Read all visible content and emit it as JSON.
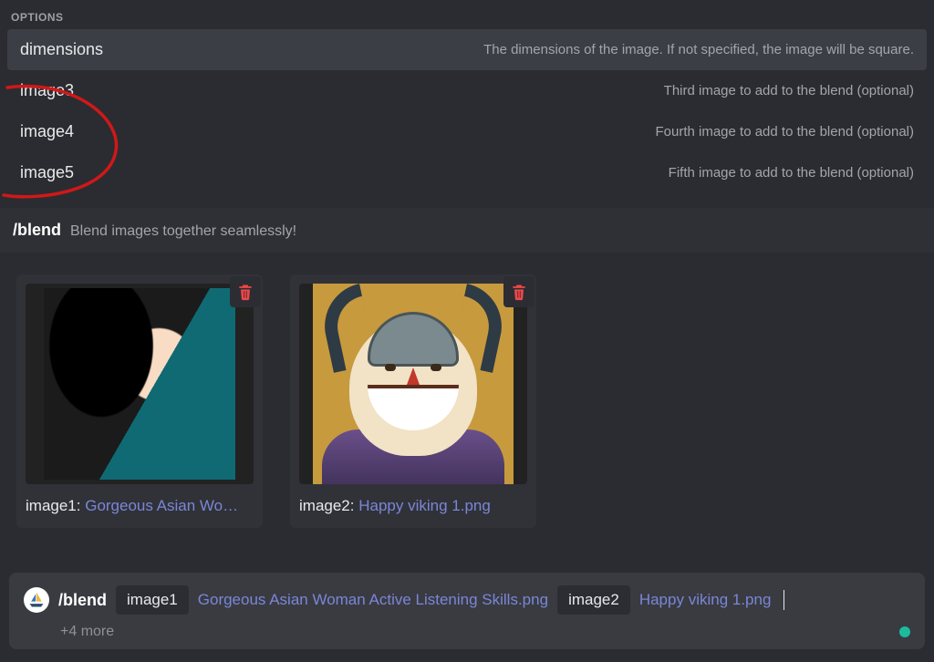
{
  "options_header": "OPTIONS",
  "options": [
    {
      "name": "dimensions",
      "desc": "The dimensions of the image. If not specified, the image will be square.",
      "active": true
    },
    {
      "name": "image3",
      "desc": "Third image to add to the blend (optional)",
      "active": false
    },
    {
      "name": "image4",
      "desc": "Fourth image to add to the blend (optional)",
      "active": false
    },
    {
      "name": "image5",
      "desc": "Fifth image to add to the blend (optional)",
      "active": false
    }
  ],
  "command": {
    "slash": "/blend",
    "desc": "Blend images together seamlessly!"
  },
  "attachments": [
    {
      "key": "image1",
      "filename": "Gorgeous Asian Wo…",
      "full_filename": "Gorgeous Asian Woman Active Listening Skills.png"
    },
    {
      "key": "image2",
      "filename": "Happy viking 1.png",
      "full_filename": "Happy viking 1.png"
    }
  ],
  "input": {
    "slash": "/blend",
    "params": [
      {
        "key": "image1",
        "value": "Gorgeous Asian Woman Active Listening Skills.png"
      },
      {
        "key": "image2",
        "value": "Happy viking 1.png"
      }
    ],
    "more": "+4 more"
  },
  "colors": {
    "accent": "#7b86d6",
    "danger": "#f04747",
    "status": "#1abc9c"
  },
  "annotation": {
    "type": "hand-drawn-circle",
    "color": "#d01818"
  }
}
